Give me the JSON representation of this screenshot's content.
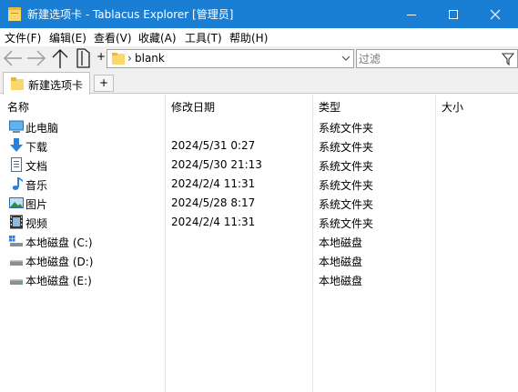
{
  "window": {
    "title": "新建选项卡 - Tablacus Explorer [管理员]",
    "title_bar_color": "#1a7fd4",
    "buttons": [
      "minimize-icon",
      "maximize-icon",
      "close-icon"
    ]
  },
  "menu": {
    "items": [
      {
        "label": "文件(F)"
      },
      {
        "label": "编辑(E)"
      },
      {
        "label": "查看(V)"
      },
      {
        "label": "收藏(A)"
      },
      {
        "label": "工具(T)"
      },
      {
        "label": "帮助(H)"
      }
    ]
  },
  "toolbar": {
    "icons": [
      "back-arrow-icon",
      "forward-arrow-icon",
      "up-arrow-icon",
      "panel-icon"
    ],
    "plus": "+",
    "address": {
      "separator": "›",
      "path": "blank"
    },
    "filter": {
      "placeholder": "过滤",
      "value": ""
    }
  },
  "tabs": {
    "items": [
      {
        "label": "新建选项卡"
      }
    ],
    "new_tab": "+"
  },
  "list": {
    "columns": [
      {
        "label": "名称"
      },
      {
        "label": "修改日期"
      },
      {
        "label": "类型"
      },
      {
        "label": "大小"
      }
    ],
    "rows": [
      {
        "icon": "computer-icon",
        "name": "此电脑",
        "date": "",
        "type": "系统文件夹",
        "size": ""
      },
      {
        "icon": "download-icon",
        "name": "下载",
        "date": "2024/5/31 0:27",
        "type": "系统文件夹",
        "size": ""
      },
      {
        "icon": "documents-icon",
        "name": "文档",
        "date": "2024/5/30 21:13",
        "type": "系统文件夹",
        "size": ""
      },
      {
        "icon": "music-icon",
        "name": "音乐",
        "date": "2024/2/4 11:31",
        "type": "系统文件夹",
        "size": ""
      },
      {
        "icon": "pictures-icon",
        "name": "图片",
        "date": "2024/5/28 8:17",
        "type": "系统文件夹",
        "size": ""
      },
      {
        "icon": "videos-icon",
        "name": "视频",
        "date": "2024/2/4 11:31",
        "type": "系统文件夹",
        "size": ""
      },
      {
        "icon": "system-drive-icon",
        "name": "本地磁盘 (C:)",
        "date": "",
        "type": "本地磁盘",
        "size": ""
      },
      {
        "icon": "drive-icon",
        "name": "本地磁盘 (D:)",
        "date": "",
        "type": "本地磁盘",
        "size": ""
      },
      {
        "icon": "drive-icon",
        "name": "本地磁盘 (E:)",
        "date": "",
        "type": "本地磁盘",
        "size": ""
      }
    ]
  }
}
